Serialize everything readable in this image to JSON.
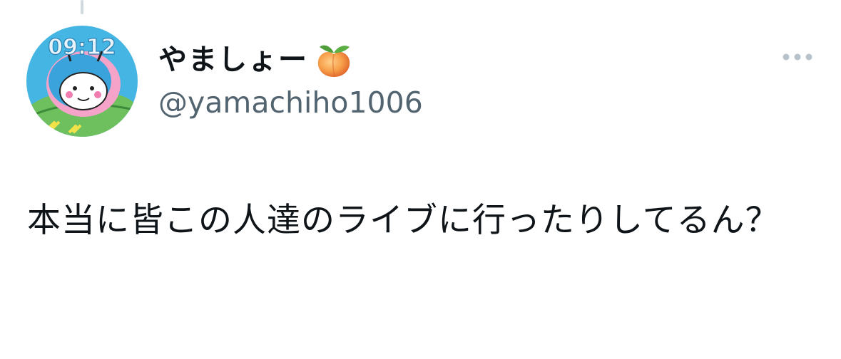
{
  "thread": {
    "connector": "thread-line"
  },
  "author": {
    "display_name": "やましょー",
    "name_emoji": "peach-icon",
    "handle": "@yamachiho1006",
    "avatar": {
      "clock_text": "09:12",
      "colors": {
        "sky": "#45b6e4",
        "hair": "#3aa3dc",
        "face": "#ffffff",
        "pink": "#f5a3c8",
        "leaf": "#6ec05e"
      }
    }
  },
  "actions": {
    "more_icon": "more-dots-icon"
  },
  "tweet": {
    "text": "本当に皆この人達のライブに行ったりしてるん？"
  },
  "colors": {
    "text_primary": "#0f1419",
    "text_secondary": "#536471",
    "icon_muted": "#b9c2ca",
    "background": "#ffffff"
  }
}
